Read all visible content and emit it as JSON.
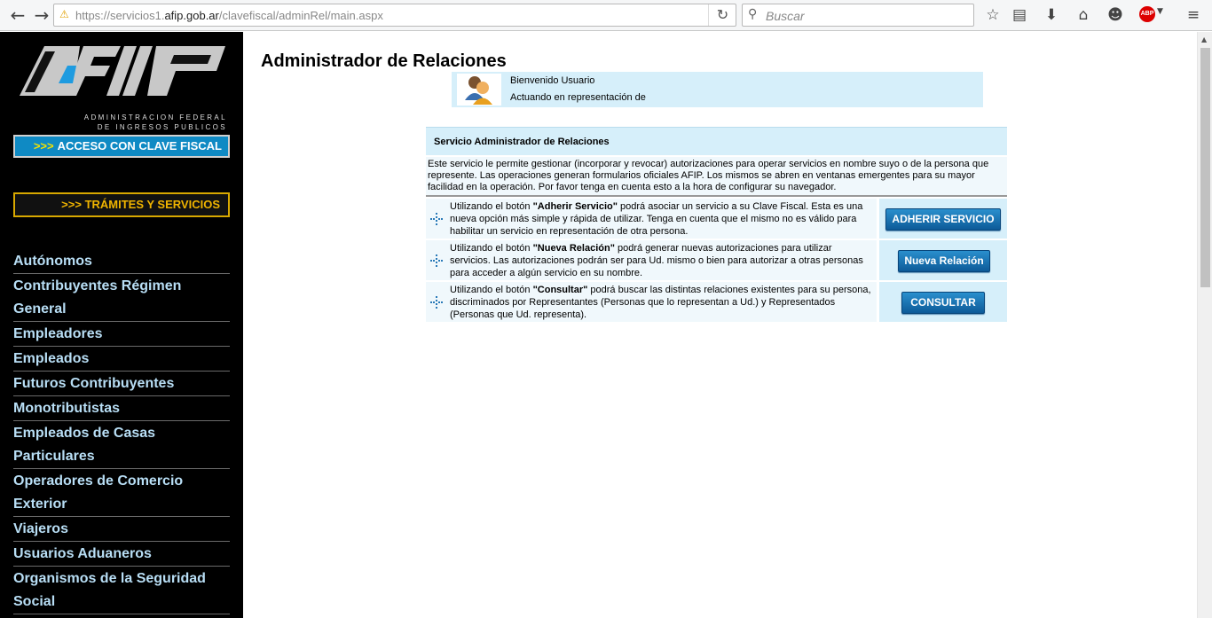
{
  "browser": {
    "back": "←",
    "forward": "→",
    "url_prefix": "https://servicios1.",
    "url_domain": "afip.gob.ar",
    "url_suffix": "/clavefiscal/adminRel/main.aspx",
    "reload": "↻",
    "search_placeholder": "Buscar",
    "icons": [
      "star-icon",
      "reading-list-icon",
      "download-icon",
      "home-icon",
      "chat-icon",
      "adblock-plus-icon",
      "menu-icon"
    ],
    "abp_label": "ABP"
  },
  "sidebar": {
    "logo_subtitle_1": "ADMINISTRACION FEDERAL",
    "logo_subtitle_2": "DE INGRESOS PUBLICOS",
    "clave_fiscal_arrows": ">>>",
    "clave_fiscal_label": "ACCESO CON CLAVE FISCAL",
    "tramites_arrows": ">>>",
    "tramites_label": "TRÁMITES Y SERVICIOS",
    "items": [
      "Autónomos",
      "Contribuyentes Régimen General",
      "Empleadores",
      "Empleados",
      "Futuros Contribuyentes",
      "Monotributistas",
      "Empleados de Casas Particulares",
      "Operadores de Comercio Exterior",
      "Viajeros",
      "Usuarios Aduaneros",
      "Organismos de la Seguridad Social"
    ]
  },
  "main": {
    "title": "Administrador de Relaciones",
    "welcome": "Bienvenido Usuario",
    "representation": "Actuando en representación de",
    "panel_title": "Servicio Administrador de Relaciones",
    "panel_description": "Este servicio le permite gestionar (incorporar y revocar) autorizaciones para operar servicios en nombre suyo o de la persona que represente. Las operaciones generan formularios oficiales AFIP. Los mismos se abren en ventanas emergentes para su mayor facilidad en la operación. Por favor tenga en cuenta esto a la hora de configurar su navegador.",
    "rows": [
      {
        "text_pre": "Utilizando el botón ",
        "text_bold": "\"Adherir Servicio\"",
        "text_post": " podrá asociar un servicio a su Clave Fiscal. Esta es una nueva opción más simple y rápida de utilizar. Tenga en cuenta que el mismo no es válido para habilitar un servicio en representación de otra persona.",
        "button": "ADHERIR SERVICIO"
      },
      {
        "text_pre": "Utilizando el botón ",
        "text_bold": "\"Nueva Relación\"",
        "text_post": " podrá generar nuevas autorizaciones para utilizar servicios. Las autorizaciones podrán ser para Ud. mismo o bien para autorizar a otras personas para acceder a algún servicio en su nombre.",
        "button": "Nueva Relación"
      },
      {
        "text_pre": "Utilizando el botón ",
        "text_bold": "\"Consultar\"",
        "text_post": " podrá buscar las distintas relaciones existentes para su persona, discriminados por Representantes (Personas que lo representan a Ud.) y Representados (Personas que Ud. representa).",
        "button": "CONSULTAR"
      }
    ]
  },
  "colors": {
    "sidebar_bg": "#000000",
    "sidebar_link": "#b8def5",
    "clave_bg": "#0f8ac4",
    "tramites_border": "#d8a800",
    "panel_bg": "#d6effa",
    "button_blue": "#0d5a98"
  }
}
